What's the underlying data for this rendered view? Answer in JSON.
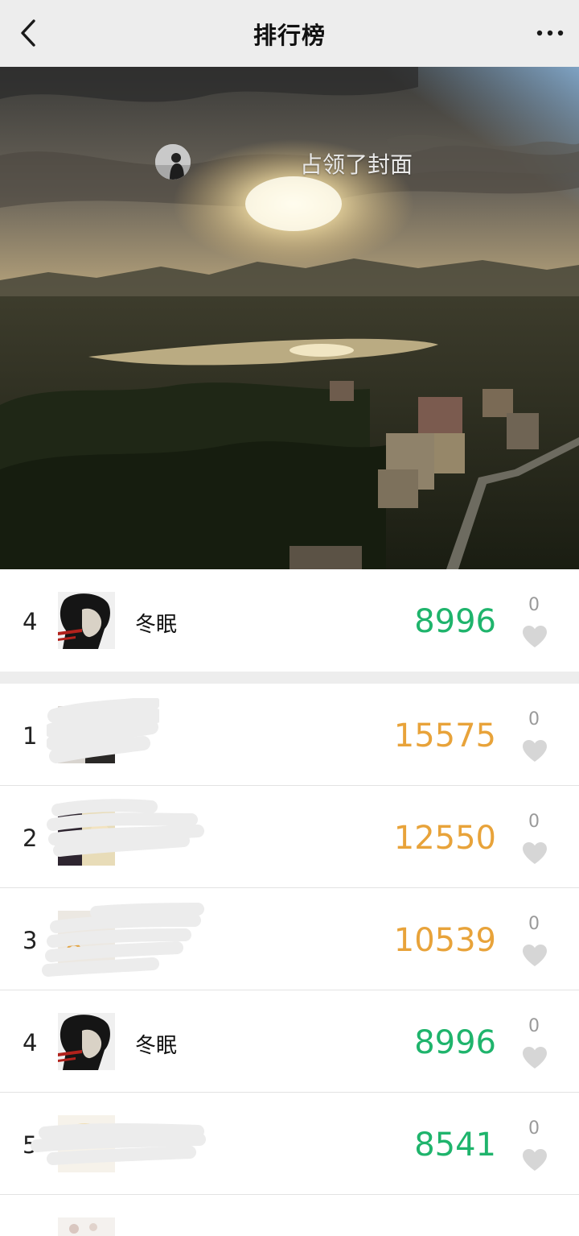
{
  "navbar": {
    "title": "排行榜"
  },
  "cover": {
    "caption": "占领了封面"
  },
  "my_rank": {
    "rank": "4",
    "name": "冬眠",
    "steps": "8996",
    "likes": "0"
  },
  "ranking": [
    {
      "rank": "1",
      "name": "",
      "steps": "15575",
      "likes": "0",
      "tier": "top"
    },
    {
      "rank": "2",
      "name": "",
      "steps": "12550",
      "likes": "0",
      "tier": "top"
    },
    {
      "rank": "3",
      "name": "",
      "steps": "10539",
      "likes": "0",
      "tier": "top"
    },
    {
      "rank": "4",
      "name": "冬眠",
      "steps": "8996",
      "likes": "0",
      "tier": "normal"
    },
    {
      "rank": "5",
      "name": "",
      "steps": "8541",
      "likes": "0",
      "tier": "normal"
    },
    {
      "rank": "",
      "name": "",
      "steps": "",
      "likes": "",
      "tier": "normal"
    }
  ],
  "colors": {
    "top_steps": "#e8a33a",
    "normal_steps": "#1fb46c",
    "background": "#ededed"
  },
  "icons": {
    "back": "chevron-left-icon",
    "more": "more-dots-icon",
    "like": "heart-icon"
  }
}
